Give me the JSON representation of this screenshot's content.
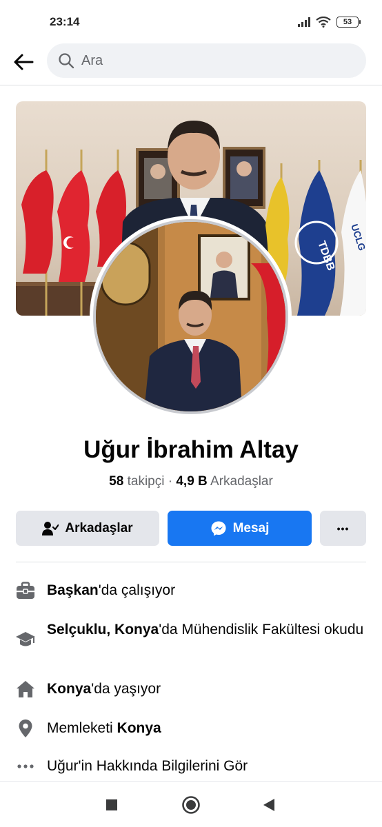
{
  "status_bar": {
    "time": "23:14",
    "battery": "53"
  },
  "search": {
    "placeholder": "Ara"
  },
  "profile": {
    "name": "Uğur İbrahim Altay",
    "followers_count": "58",
    "followers_label": "takipçi",
    "separator": "·",
    "friends_count": "4,9 B",
    "friends_label": "Arkadaşlar"
  },
  "actions": {
    "friends_label": "Arkadaşlar",
    "message_label": "Mesaj",
    "more_label": "•••"
  },
  "cover": {
    "flag_labels": [
      "TDBB",
      "UCLG"
    ]
  },
  "info": {
    "work": {
      "bold": "Başkan",
      "rest": "'da çalışıyor"
    },
    "education": {
      "bold": "Selçuklu, Konya",
      "rest": "'da Mühendislik Fakültesi okudu"
    },
    "lives": {
      "bold": "Konya",
      "rest": "'da yaşıyor"
    },
    "hometown": {
      "prefix": "Memleketi ",
      "bold": "Konya"
    },
    "about": {
      "text": "Uğur'in Hakkında Bilgilerini Gör"
    }
  },
  "colors": {
    "primary": "#1877f2",
    "secondary_button": "#e4e6eb",
    "muted_text": "#65676b"
  }
}
